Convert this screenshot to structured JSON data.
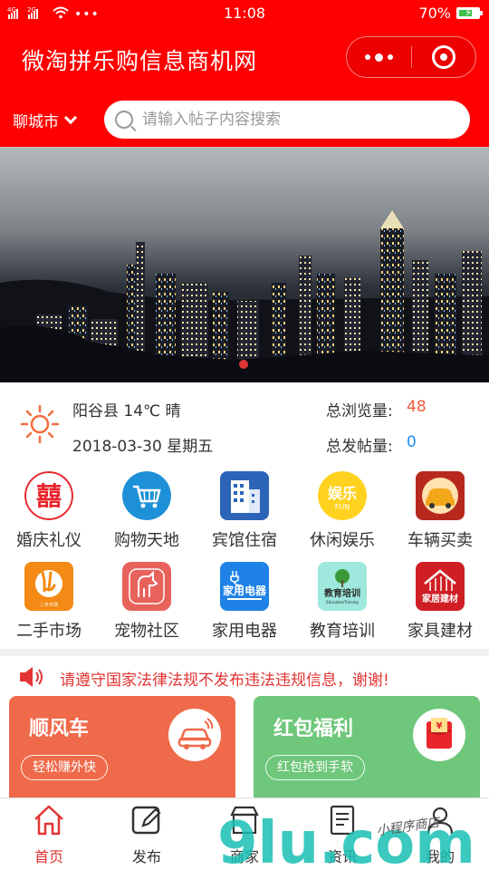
{
  "status_bar": {
    "network_left": "4G 2G",
    "time": "11:08",
    "battery": "70%",
    "battery_level": 0.7
  },
  "header": {
    "title": "微淘拼乐购信息商机网",
    "city": "聊城市",
    "search_placeholder": "请输入帖子内容搜索"
  },
  "colors": {
    "brand_red": "#ff0000",
    "notice_red": "#e23434",
    "views_orange": "#f05a3c",
    "posts_blue": "#1e8cf0",
    "card_orange": "#ef6a4a",
    "card_green": "#6ec77a"
  },
  "info": {
    "weather": "阳谷县 14℃ 晴",
    "date": "2018-03-30 星期五",
    "views_label": "总浏览量:",
    "views_value": "48",
    "posts_label": "总发帖量:",
    "posts_value": "0"
  },
  "categories": [
    {
      "label": "婚庆礼仪",
      "icon": "double-happiness-icon"
    },
    {
      "label": "购物天地",
      "icon": "shopping-cart-icon"
    },
    {
      "label": "宾馆住宿",
      "icon": "hotel-building-icon"
    },
    {
      "label": "休闲娱乐",
      "icon": "entertainment-fun-icon"
    },
    {
      "label": "车辆买卖",
      "icon": "car-icon"
    },
    {
      "label": "二手市场",
      "icon": "second-hand-hand-icon"
    },
    {
      "label": "宠物社区",
      "icon": "pet-dog-icon"
    },
    {
      "label": "家用电器",
      "icon": "appliance-plug-icon"
    },
    {
      "label": "教育培训",
      "icon": "education-tree-icon"
    },
    {
      "label": "家具建材",
      "icon": "furniture-house-icon"
    }
  ],
  "notice": {
    "text": "请遵守国家法律法规不发布违法违规信息，谢谢!"
  },
  "cards": [
    {
      "title": "顺风车",
      "button": "轻松赚外快",
      "icon": "car-ride-icon"
    },
    {
      "title": "红包福利",
      "button": "红包抢到手软",
      "icon": "red-envelope-icon"
    }
  ],
  "tabs": [
    {
      "label": "首页",
      "icon": "home-icon",
      "active": true
    },
    {
      "label": "发布",
      "icon": "edit-icon",
      "active": false
    },
    {
      "label": "商家",
      "icon": "store-icon",
      "active": false
    },
    {
      "label": "资讯",
      "icon": "news-icon",
      "active": false
    },
    {
      "label": "我的",
      "icon": "user-icon",
      "active": false
    }
  ],
  "watermark": {
    "text": "9lu.com",
    "script_text": "小程序商店"
  }
}
